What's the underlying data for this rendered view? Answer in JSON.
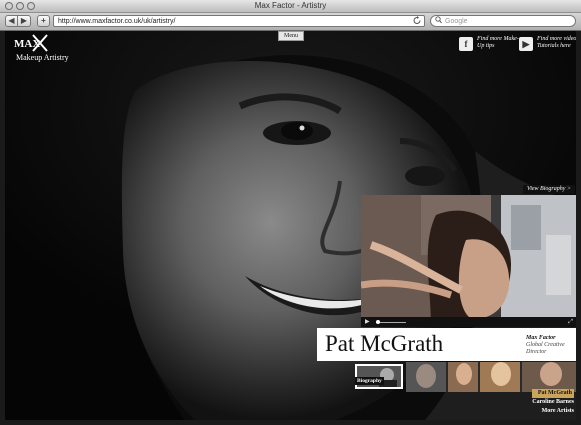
{
  "window": {
    "title": "Max Factor - Artistry"
  },
  "toolbar": {
    "back_label": "◀",
    "forward_label": "▶",
    "add_label": "+",
    "url": "http://www.maxfactor.co.uk/uk/artistry/",
    "reload_label": "C",
    "search_placeholder": "Google"
  },
  "header": {
    "logo_text": "MAX",
    "menu_label": "Menu",
    "section_title": "Makeup Artistry",
    "promos": [
      {
        "icon": "f",
        "text": "Find more Make-Up tips"
      },
      {
        "icon": "▶",
        "text": "Find more video Tutorials here"
      }
    ]
  },
  "video": {
    "view_biography_label": "View Biography >",
    "play_label": "▶",
    "fullscreen_label": "⤢"
  },
  "artist": {
    "name": "Pat McGrath",
    "company": "Max Factor",
    "role": "Global Creative Director",
    "biography_label": "Biography"
  },
  "artists": [
    {
      "name": "Pat McGrath",
      "active": true
    },
    {
      "name": "Caroline Barnes",
      "active": false
    },
    {
      "name": "More Artists",
      "active": false
    }
  ],
  "colors": {
    "accent": "#c9a45a"
  }
}
